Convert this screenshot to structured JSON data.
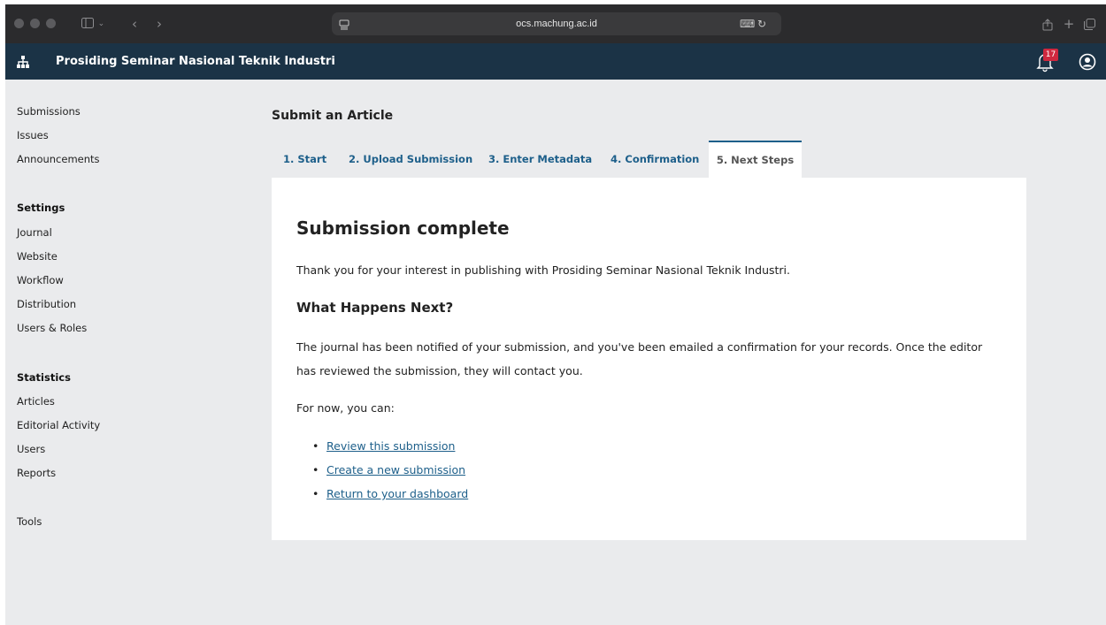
{
  "browser": {
    "url": "ocs.machung.ac.id"
  },
  "header": {
    "title": "Prosiding Seminar Nasional Teknik Industri",
    "notification_count": "17"
  },
  "sidebar": {
    "top_items": [
      "Submissions",
      "Issues",
      "Announcements"
    ],
    "settings_heading": "Settings",
    "settings_items": [
      "Journal",
      "Website",
      "Workflow",
      "Distribution",
      "Users & Roles"
    ],
    "statistics_heading": "Statistics",
    "statistics_items": [
      "Articles",
      "Editorial Activity",
      "Users",
      "Reports"
    ],
    "tools_label": "Tools"
  },
  "main": {
    "page_title": "Submit an Article",
    "tabs": [
      "1. Start",
      "2. Upload Submission",
      "3. Enter Metadata",
      "4. Confirmation",
      "5. Next Steps"
    ],
    "active_tab": "5. Next Steps",
    "heading": "Submission complete",
    "thanks_text": "Thank you for your interest in publishing with Prosiding Seminar Nasional Teknik Industri.",
    "next_heading": "What Happens Next?",
    "next_text": "The journal has been notified of your submission, and you've been emailed a confirmation for your records. Once the editor has reviewed the submission, they will contact you.",
    "for_now_text": "For now, you can:",
    "links": [
      "Review this submission",
      "Create a new submission",
      "Return to your dashboard"
    ]
  },
  "colors": {
    "header_bg": "#1b3346",
    "link": "#1d5f8a",
    "badge": "#d0283f",
    "page_bg": "#eaebed"
  },
  "icons": [
    "sitemap-icon",
    "bell-icon",
    "user-circle-icon",
    "sidebar-toggle-icon",
    "back-icon",
    "forward-icon",
    "share-icon",
    "new-tab-icon",
    "tabs-overview-icon",
    "translate-icon",
    "reload-icon",
    "page-icon"
  ]
}
